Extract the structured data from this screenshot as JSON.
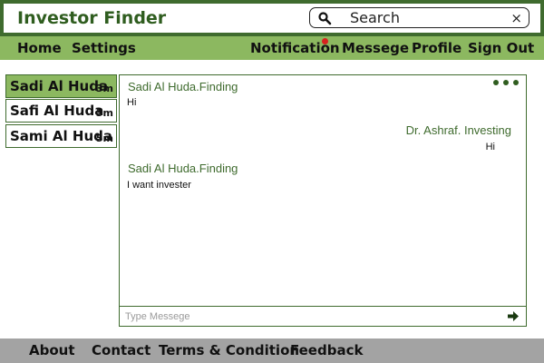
{
  "app": {
    "title": "Investor Finder"
  },
  "search": {
    "placeholder": "Search",
    "icon": "search-icon",
    "clear_icon": "close-icon"
  },
  "nav": {
    "home": "Home",
    "settings": "Settings",
    "notification": "Notification",
    "message": "Messege",
    "profile": "Profile",
    "signout": "Sign Out",
    "notification_dot_color": "#d8231f"
  },
  "contacts": [
    {
      "name": "Sadi Al Huda",
      "time": "3m",
      "active": true
    },
    {
      "name": "Safi Al Huda",
      "time": "3m",
      "active": false
    },
    {
      "name": "Sami Al Huda",
      "time": "5m",
      "active": false
    }
  ],
  "chat": {
    "messages": [
      {
        "sender": "Sadi Al Huda.Finding",
        "text": "Hi",
        "align": "left"
      },
      {
        "sender": "Dr. Ashraf. Investing",
        "text": "Hi",
        "align": "right"
      },
      {
        "sender": "Sadi Al Huda.Finding",
        "text": "I want invester",
        "align": "left"
      }
    ],
    "compose_placeholder": "Type Messege",
    "more_icon": "more-dots-icon",
    "send_icon": "send-arrow-icon"
  },
  "footer": {
    "about": "About",
    "contact": "Contact",
    "terms": "Terms & Condition",
    "feedback": "Feedback"
  },
  "colors": {
    "primary": "#3f6b2e",
    "nav_bg": "#8cb860",
    "footer_bg": "#a3a3a3"
  }
}
